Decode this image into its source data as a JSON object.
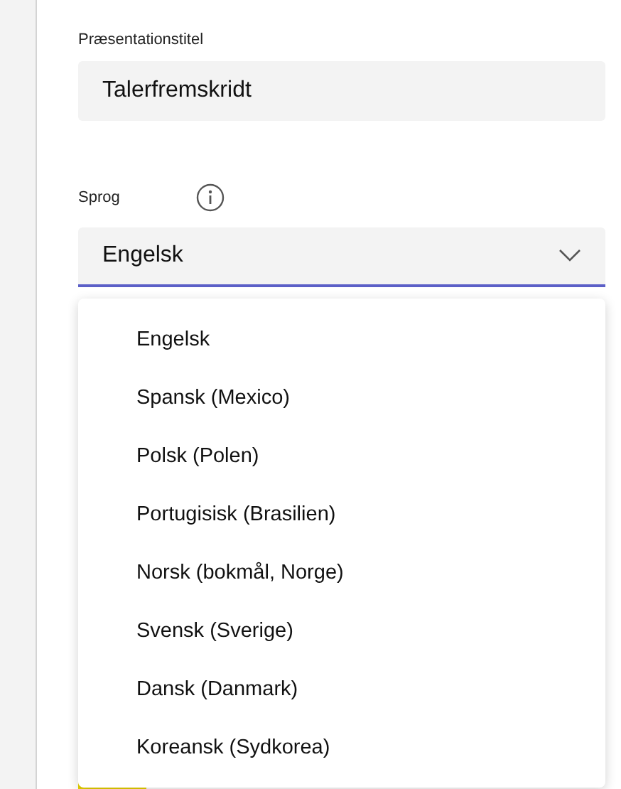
{
  "title_field": {
    "label": "Præsentationstitel",
    "value": "Talerfremskridt"
  },
  "language": {
    "label": "Sprog",
    "value": "Engelsk",
    "expanded": true,
    "options": [
      {
        "label": "Engelsk"
      },
      {
        "label": "Spansk (Mexico)"
      },
      {
        "label": "Polsk (Polen)"
      },
      {
        "label": "Portugisisk (Brasilien)"
      },
      {
        "label": "Norsk (bokmål, Norge)"
      },
      {
        "label": "Svensk (Sverige)"
      },
      {
        "label": "Dansk (Danmark)"
      },
      {
        "label": "Koreansk (Sydkorea)"
      }
    ]
  }
}
